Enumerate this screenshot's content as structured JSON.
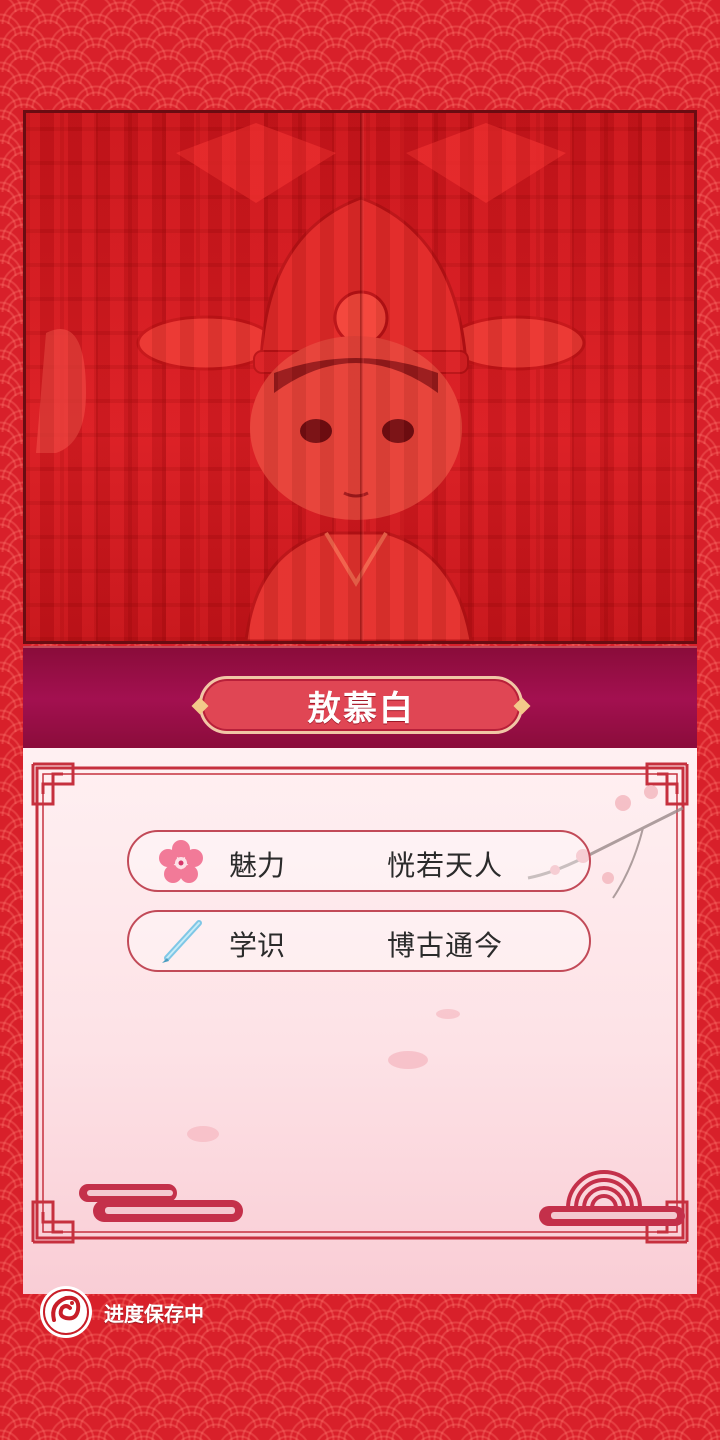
{
  "character": {
    "name": "敖慕白"
  },
  "stats": [
    {
      "icon": "plum-blossom-icon",
      "label": "魅力",
      "value": "恍若天人"
    },
    {
      "icon": "brush-pen-icon",
      "label": "学识",
      "value": "博古通今"
    }
  ],
  "status": {
    "save_text": "进度保存中",
    "icon": "dragon-emblem-icon"
  },
  "colors": {
    "background": "#d8202a",
    "name_band": "#a31050",
    "name_plate": "#e04654",
    "card": "#fde2e6",
    "frame": "#c24a58"
  }
}
